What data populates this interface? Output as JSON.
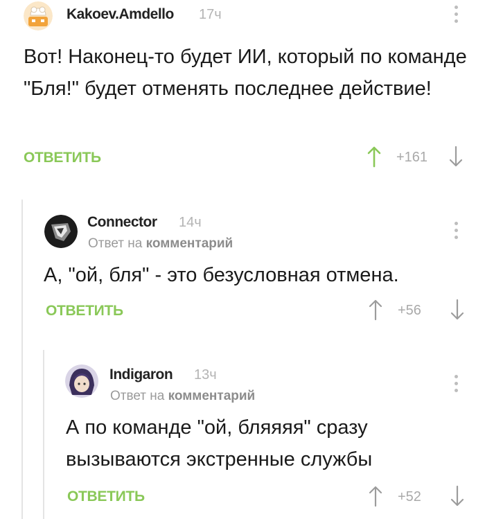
{
  "comments": [
    {
      "username": "Kakoev.Amdello",
      "time": "17ч",
      "text": "Вот! Наконец-то будет ИИ, который по команде \"Бля!\" будет отменять последнее действие!",
      "reply_label": "ОТВЕТИТЬ",
      "rating": "+161",
      "upvoted": true
    },
    {
      "username": "Connector",
      "time": "14ч",
      "reply_prefix": "Ответ на",
      "reply_target": "комментарий",
      "text": "А, \"ой, бля\" - это безусловная отмена.",
      "reply_label": "ОТВЕТИТЬ",
      "rating": "+56",
      "upvoted": false
    },
    {
      "username": "Indigaron",
      "time": "13ч",
      "reply_prefix": "Ответ на",
      "reply_target": "комментарий",
      "text": "А по команде \"ой, бляяяя\" сразу вызываются экстренные службы",
      "reply_label": "ОТВЕТИТЬ",
      "rating": "+52",
      "upvoted": false
    }
  ],
  "colors": {
    "accent_green": "#8ac858",
    "muted_gray": "#a9a9a9",
    "thread_line": "#e4e4e4"
  },
  "icons": {
    "more": "more-vertical-icon",
    "upvote": "arrow-up-icon",
    "downvote": "arrow-down-icon"
  }
}
